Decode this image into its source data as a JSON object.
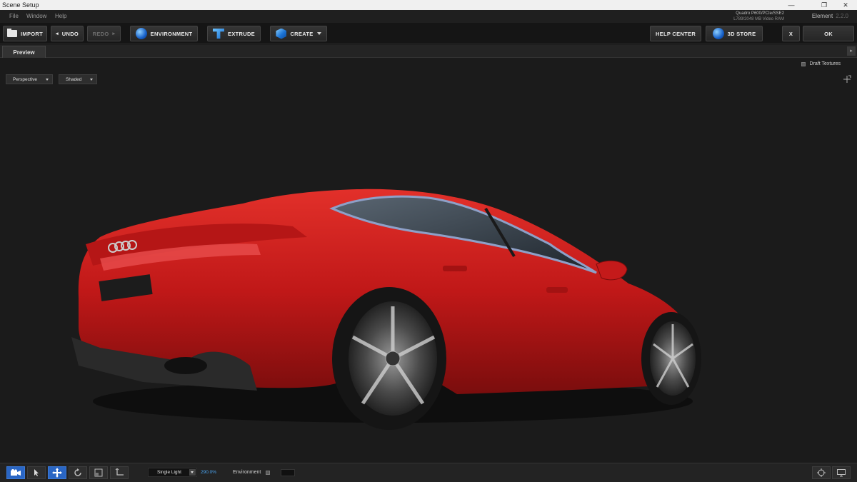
{
  "window": {
    "title": "Scene Setup",
    "minimize": "—",
    "restore": "❐",
    "close": "✕"
  },
  "menu": {
    "file": "File",
    "window": "Window",
    "help": "Help"
  },
  "system_info": {
    "gpu_line1": "Quadro P600/PCIe/SSE2",
    "gpu_line2": "L789/2048 MB Video RAM",
    "product": "Element",
    "version": "2.2.0"
  },
  "toolbar": {
    "import": "IMPORT",
    "undo": "UNDO",
    "redo": "REDO",
    "environment": "ENVIRONMENT",
    "extrude": "EXTRUDE",
    "create": "CREATE",
    "help_center": "HELP CENTER",
    "store": "3D STORE",
    "close": "X",
    "ok": "OK"
  },
  "tabs": {
    "preview": "Preview"
  },
  "viewport": {
    "view_mode": "Perspective",
    "shading_mode": "Shaded",
    "draft_textures": "Draft Textures",
    "draft_textures_checked": false
  },
  "statusbar": {
    "light_mode": "Single Light",
    "light_intensity": "290.0%",
    "environment_label": "Environment",
    "environment_checked": false,
    "active_tool": "camera"
  },
  "colors": {
    "accent": "#2a66c4",
    "percent_text": "#4aa3f0",
    "car_paint": "#c8191c",
    "viewport_bg": "#1b1b1b"
  }
}
